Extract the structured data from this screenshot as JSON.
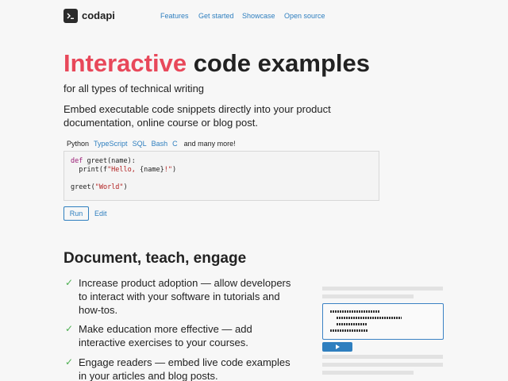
{
  "header": {
    "logo_text": "codapi",
    "nav": [
      {
        "label": "Features"
      },
      {
        "label": "Get started"
      },
      {
        "label": "Showcase"
      },
      {
        "label": "Open source"
      }
    ]
  },
  "hero": {
    "title_accent": "Interactive",
    "title_rest": " code examples",
    "subtitle": "for all types of technical writing",
    "embed_text": "Embed executable code snippets directly into your product documentation, online course or blog post."
  },
  "languages": {
    "tabs": [
      "Python",
      "TypeScript",
      "SQL",
      "Bash",
      "C"
    ],
    "active": "Python",
    "more": "and many more!"
  },
  "code": {
    "lines": [
      "def greet(name):",
      "  print(f\"Hello, {name}!\")",
      "",
      "greet(\"World\")"
    ]
  },
  "actions": {
    "run_label": "Run",
    "edit_label": "Edit"
  },
  "features": {
    "title": "Document, teach, engage",
    "check_glyph": "✓",
    "items": [
      {
        "text": "Increase product adoption — allow developers to interact with your software in tutorials and how-tos."
      },
      {
        "text": "Make education more effective — add interactive exercises to your courses."
      },
      {
        "text": "Engage readers — embed live code examples in your articles and blog posts."
      }
    ]
  },
  "colors": {
    "accent_red": "#e8485a",
    "link_blue": "#2f7fbf",
    "check_green": "#4caf50"
  }
}
